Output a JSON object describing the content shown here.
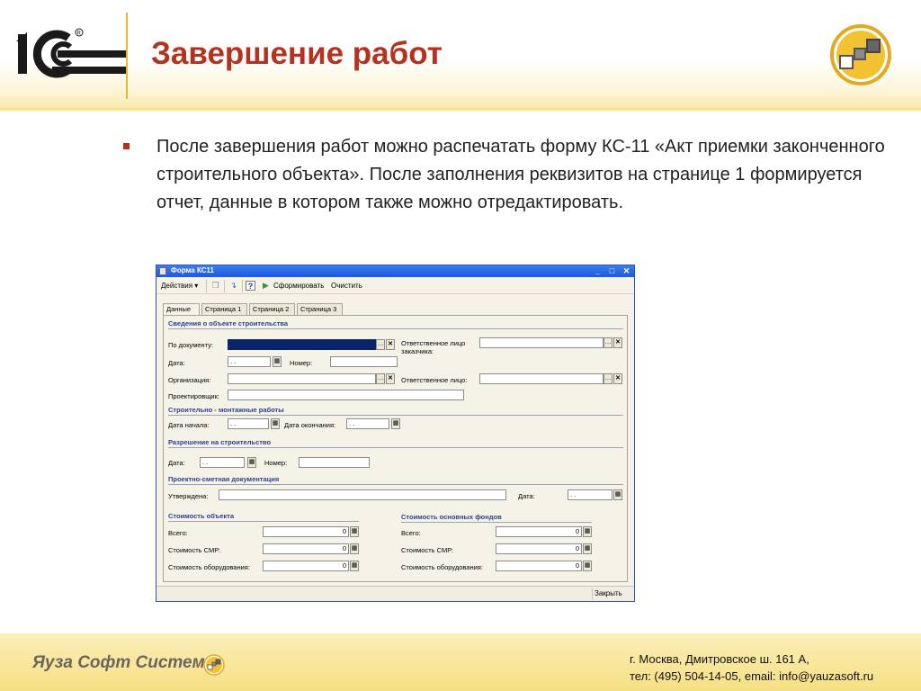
{
  "slide": {
    "title": "Завершение работ",
    "body": "После завершения работ можно распечатать форму КС-11 «Акт приемки законченного строительного объекта». После заполнения реквизитов на странице 1 формируется отчет, данные в котором также можно отредактировать."
  },
  "window": {
    "title": "Форма КС11",
    "toolbar": {
      "actions_label": "Действия ▾",
      "generate_label": "Сформировать",
      "clear_label": "Очистить"
    },
    "tabs": [
      "Данные",
      "Страница 1",
      "Страница 2",
      "Страница 3"
    ],
    "sections": {
      "object": "Сведения о объекте строительства",
      "construction": "Строительно - монтажные работы",
      "permit": "Разрешение на строительство",
      "design_docs": "Проектно-сметная документация",
      "object_cost": "Стоимость объекта",
      "fixed_assets_cost": "Стоимость основных фондов"
    },
    "labels": {
      "by_document": "По документу:",
      "customer_responsible_line1": "Ответственное лицо",
      "customer_responsible_line2": "заказчика:",
      "date": "Дата:",
      "number": "Номер:",
      "organization": "Организация:",
      "responsible": "Ответственное лицо:",
      "designer": "Проектировщик:",
      "start_date": "Дата начала:",
      "end_date": "Дата окончания:",
      "permit_date": "Дата:",
      "permit_number": "Номер:",
      "approved": "Утверждена:",
      "approved_date": "Дата:",
      "total": "Всего:",
      "smr_cost": "Стоимость СМР:",
      "equipment_cost": "Стоимость оборудования:",
      "fa_total": "Всего:",
      "fa_smr_cost": "Стоимость СМР:",
      "fa_equipment_cost": "Стоимость оборудования:"
    },
    "values": {
      "date_empty": " .  .",
      "object_total": "0",
      "object_smr": "0",
      "object_equipment": "0",
      "fa_total": "0",
      "fa_smr": "0",
      "fa_equipment": "0"
    },
    "close_label": "Закрыть"
  },
  "footer": {
    "brand": "Яуза Софт Системз",
    "address": "г. Москва, Дмитровское ш. 161 А,",
    "contacts": "тел: (495) 504-14-05, email: info@yauzasoft.ru"
  },
  "colors": {
    "title_red": "#b5321f",
    "accent_gold": "#e5b92c",
    "window_blue": "#2a52b8"
  },
  "icons": [
    "1c-logo",
    "yauza-cubes-logo",
    "copy-icon",
    "move-icon",
    "help-icon",
    "play-icon",
    "calendar-icon",
    "select-icon",
    "clear-icon"
  ]
}
